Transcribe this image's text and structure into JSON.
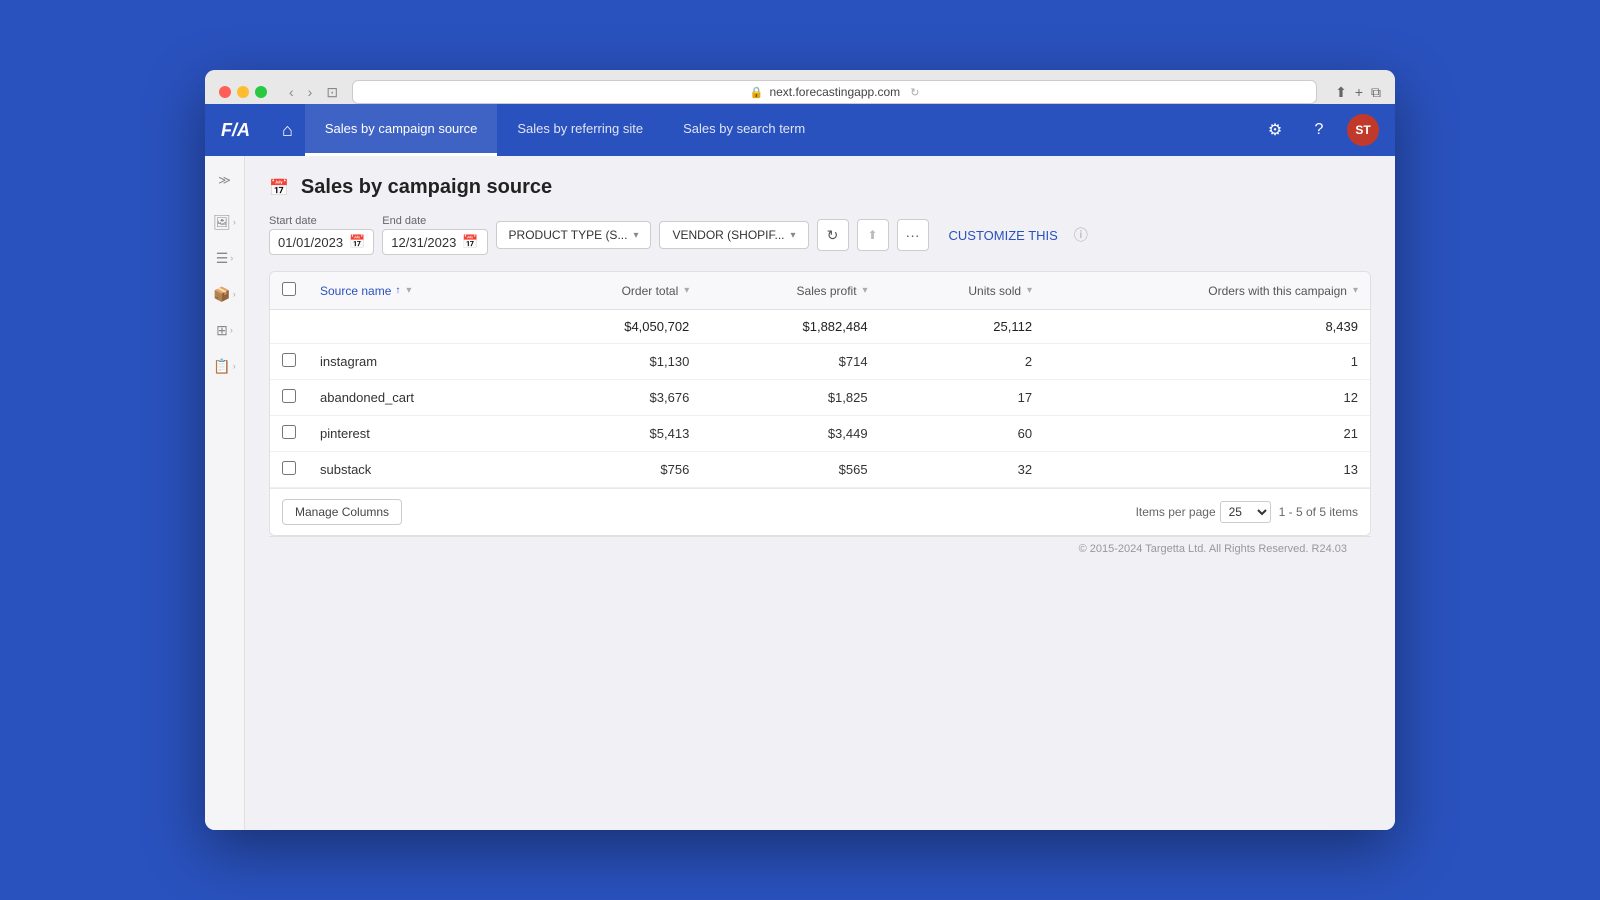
{
  "browser": {
    "url": "next.forecastingapp.com",
    "back_btn": "‹",
    "forward_btn": "›"
  },
  "logo": "F/A",
  "nav": {
    "home_icon": "⌂",
    "tabs": [
      {
        "label": "Sales by campaign source",
        "active": true
      },
      {
        "label": "Sales by referring site",
        "active": false
      },
      {
        "label": "Sales by search term",
        "active": false
      }
    ],
    "settings_icon": "⚙",
    "help_icon": "?",
    "avatar_initials": "ST"
  },
  "sidebar": {
    "toggle_label": "≫",
    "items": [
      {
        "icon": "🖼",
        "arrow": "›"
      },
      {
        "icon": "☰",
        "arrow": "›"
      },
      {
        "icon": "📦",
        "arrow": "›"
      },
      {
        "icon": "⊞",
        "arrow": "›"
      },
      {
        "icon": "📋",
        "arrow": "›"
      }
    ]
  },
  "page": {
    "title": "Sales by campaign source",
    "start_date_label": "Start date",
    "start_date_value": "01/01/2023",
    "end_date_label": "End date",
    "end_date_value": "12/31/2023",
    "filter1_label": "PRODUCT TYPE (S...",
    "filter2_label": "VENDOR (SHOPIF...",
    "refresh_icon": "↻",
    "export_icon": "⬆",
    "more_icon": "···",
    "customize_label": "CUSTOMIZE THIS",
    "help_icon": "ⓘ"
  },
  "table": {
    "columns": [
      {
        "key": "source_name",
        "label": "Source name",
        "sort": "asc",
        "active": true
      },
      {
        "key": "order_total",
        "label": "Order total",
        "sort": "filter"
      },
      {
        "key": "sales_profit",
        "label": "Sales profit",
        "sort": "filter"
      },
      {
        "key": "units_sold",
        "label": "Units sold",
        "sort": "filter"
      },
      {
        "key": "orders_with_campaign",
        "label": "Orders with this campaign",
        "sort": "filter"
      }
    ],
    "totals": {
      "source_name": "",
      "order_total": "$4,050,702",
      "sales_profit": "$1,882,484",
      "units_sold": "25,112",
      "orders_with_campaign": "8,439"
    },
    "rows": [
      {
        "source_name": "instagram",
        "order_total": "$1,130",
        "sales_profit": "$714",
        "units_sold": "2",
        "orders_with_campaign": "1"
      },
      {
        "source_name": "abandoned_cart",
        "order_total": "$3,676",
        "sales_profit": "$1,825",
        "units_sold": "17",
        "orders_with_campaign": "12"
      },
      {
        "source_name": "pinterest",
        "order_total": "$5,413",
        "sales_profit": "$3,449",
        "units_sold": "60",
        "orders_with_campaign": "21"
      },
      {
        "source_name": "substack",
        "order_total": "$756",
        "sales_profit": "$565",
        "units_sold": "32",
        "orders_with_campaign": "13"
      }
    ],
    "footer": {
      "manage_cols_label": "Manage Columns",
      "items_per_page_label": "Items per page",
      "items_per_page_value": "25",
      "pagination_text": "1 - 5 of 5 items"
    }
  },
  "footer": {
    "copyright": "© 2015-2024 Targetta Ltd. All Rights Reserved. R24.03"
  }
}
